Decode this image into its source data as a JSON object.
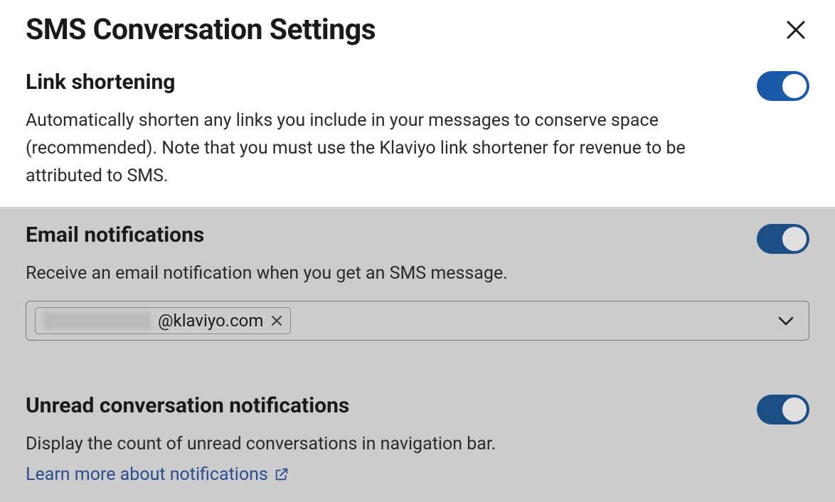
{
  "header": {
    "title": "SMS Conversation Settings"
  },
  "sections": {
    "link_shortening": {
      "title": "Link shortening",
      "description": "Automatically shorten any links you include in your messages to conserve space (recommended). Note that you must use the Klaviyo link shortener for revenue to be attributed to SMS.",
      "enabled": true
    },
    "email_notifications": {
      "title": "Email notifications",
      "description": "Receive an email notification when you get an SMS message.",
      "enabled": true,
      "email_chip": {
        "domain": "@klaviyo.com"
      }
    },
    "unread_notifications": {
      "title": "Unread conversation notifications",
      "description": "Display the count of unread conversations in navigation bar.",
      "enabled": true,
      "link_text": "Learn more about notifications"
    }
  }
}
